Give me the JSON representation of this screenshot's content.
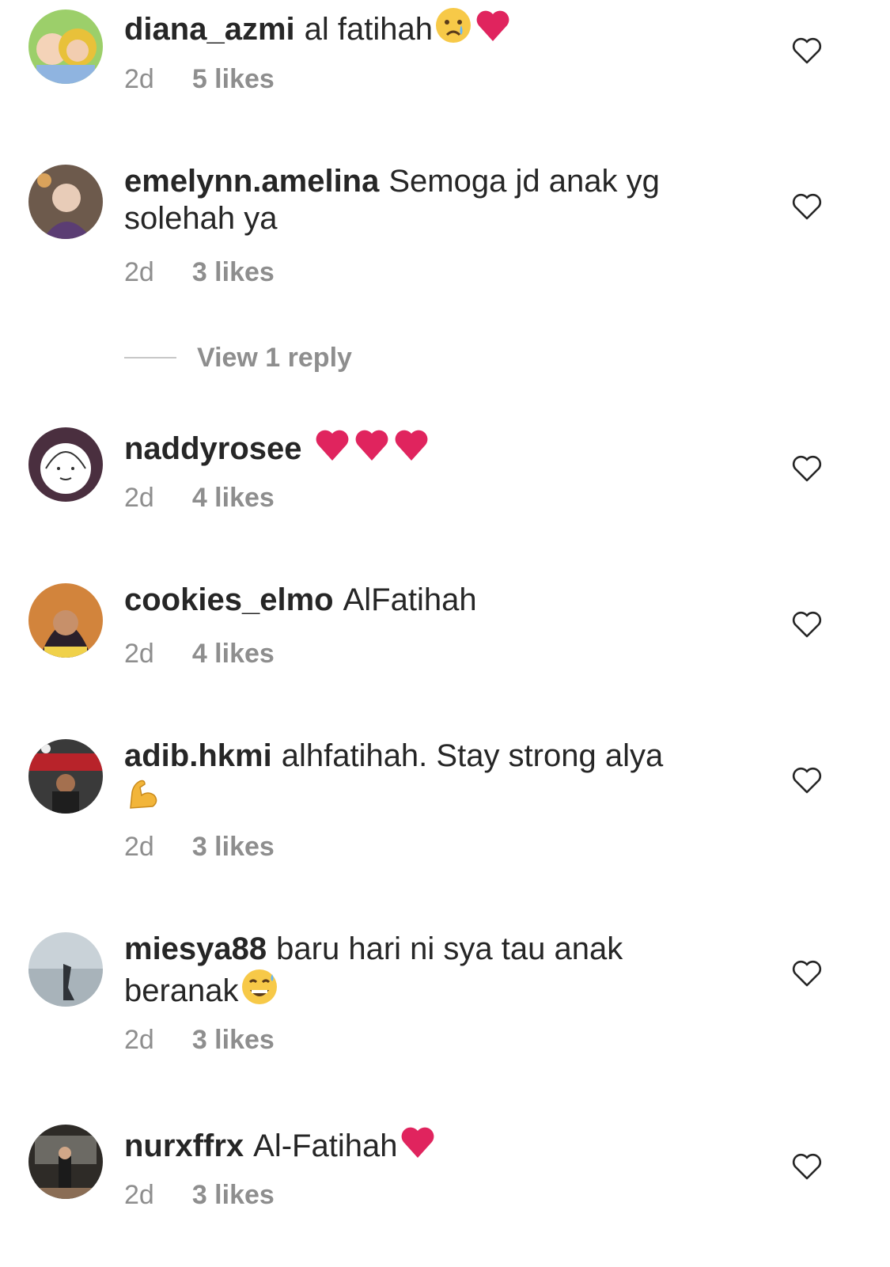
{
  "comments": [
    {
      "username": "diana_azmi",
      "text": "al fatihah",
      "emojis": [
        "crying-face",
        "red-heart"
      ],
      "time": "2d",
      "likes": "5 likes",
      "avatar": "avatar-diana"
    },
    {
      "username": "emelynn.amelina",
      "text": "Semoga jd anak yg solehah ya",
      "emojis": [],
      "time": "2d",
      "likes": "3 likes",
      "avatar": "avatar-emelynn"
    },
    {
      "username": "naddyrosee",
      "text": "",
      "emojis": [
        "red-heart",
        "red-heart",
        "red-heart"
      ],
      "time": "2d",
      "likes": "4 likes",
      "avatar": "avatar-naddy"
    },
    {
      "username": "cookies_elmo",
      "text": "AlFatihah",
      "emojis": [],
      "time": "2d",
      "likes": "4 likes",
      "avatar": "avatar-cookies"
    },
    {
      "username": "adib.hkmi",
      "text": "alhfatihah. Stay strong alya",
      "emojis": [
        "flexed-biceps"
      ],
      "time": "2d",
      "likes": "3 likes",
      "avatar": "avatar-adib"
    },
    {
      "username": "miesya88",
      "text": "baru hari ni sya tau anak beranak",
      "emojis": [
        "grinning-sweat-face"
      ],
      "time": "2d",
      "likes": "3 likes",
      "avatar": "avatar-miesya"
    },
    {
      "username": "nurxffrx",
      "text": "Al-Fatihah",
      "emojis": [
        "red-heart"
      ],
      "time": "2d",
      "likes": "3 likes",
      "avatar": "avatar-nurx"
    }
  ],
  "view_reply": {
    "label": "View 1 reply"
  },
  "colors": {
    "text": "#262626",
    "secondary": "#8e8e8e",
    "heart_red": "#e0245e"
  }
}
